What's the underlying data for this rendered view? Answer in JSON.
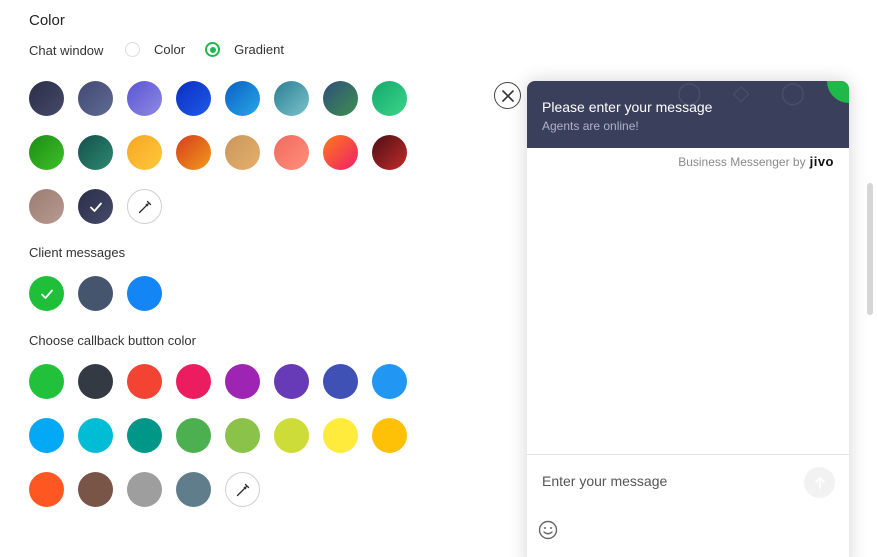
{
  "section_title": "Color",
  "chat_window": {
    "label": "Chat window",
    "options": [
      {
        "label": "Color",
        "checked": false
      },
      {
        "label": "Gradient",
        "checked": true
      }
    ],
    "swatches": [
      {
        "bg": "linear-gradient(135deg,#2a2e48,#454a69)",
        "selected": false
      },
      {
        "bg": "linear-gradient(135deg,#414a72,#616a93)",
        "selected": false
      },
      {
        "bg": "linear-gradient(135deg,#5a54d3,#8f8ae3)",
        "selected": false
      },
      {
        "bg": "linear-gradient(135deg,#0b2fc2,#1f5ae8)",
        "selected": false
      },
      {
        "bg": "linear-gradient(135deg,#0b5fc4,#26a8e6)",
        "selected": false
      },
      {
        "bg": "linear-gradient(135deg,#2b7e93,#7bc3cc)",
        "selected": false
      },
      {
        "bg": "linear-gradient(135deg,#2e4e7a,#3f8f4f)",
        "selected": false
      },
      {
        "bg": "linear-gradient(135deg,#15a86a,#3ad58b)",
        "selected": false
      },
      {
        "bg": "linear-gradient(135deg,#1d8c14,#3ec02a)",
        "selected": false
      },
      {
        "bg": "linear-gradient(135deg,#134f4b,#2e8a70)",
        "selected": false
      },
      {
        "bg": "linear-gradient(135deg,#f6a623,#ffc93b)",
        "selected": false
      },
      {
        "bg": "linear-gradient(135deg,#d63c1f,#f29b1a)",
        "selected": false
      },
      {
        "bg": "linear-gradient(135deg,#c8975b,#e6b06c)",
        "selected": false
      },
      {
        "bg": "linear-gradient(135deg,#f26a5e,#ff8f7a)",
        "selected": false
      },
      {
        "bg": "linear-gradient(135deg,#ff7a1a,#ee1f6a)",
        "selected": false
      },
      {
        "bg": "linear-gradient(135deg,#4a1014,#c42a2a)",
        "selected": false
      },
      {
        "bg": "linear-gradient(135deg,#9c7c74,#b79a90)",
        "selected": false
      },
      {
        "bg": "linear-gradient(135deg,#2a2e48,#454a69)",
        "selected": true
      }
    ]
  },
  "client_messages": {
    "label": "Client messages",
    "swatches": [
      {
        "bg": "#1fbf3a",
        "selected": true
      },
      {
        "bg": "#46556e",
        "selected": false
      },
      {
        "bg": "#1385f5",
        "selected": false
      }
    ]
  },
  "callback": {
    "label": "Choose callback button color",
    "swatches": [
      "#21c13c",
      "#333a44",
      "#f24333",
      "#ec1c60",
      "#9e25b3",
      "#673ab7",
      "#3f51b5",
      "#2196f3",
      "#03a9f4",
      "#00bcd4",
      "#009688",
      "#4caf50",
      "#8bc34a",
      "#cddc39",
      "#ffeb3b",
      "#ffc107",
      "#ff5722",
      "#795548",
      "#9e9e9e",
      "#607d8b"
    ]
  },
  "widget": {
    "header_title": "Please enter your message",
    "header_subtitle": "Agents are online!",
    "branding_text": "Business Messenger by",
    "brand_logo": "jivo",
    "input_placeholder": "Enter your message"
  }
}
